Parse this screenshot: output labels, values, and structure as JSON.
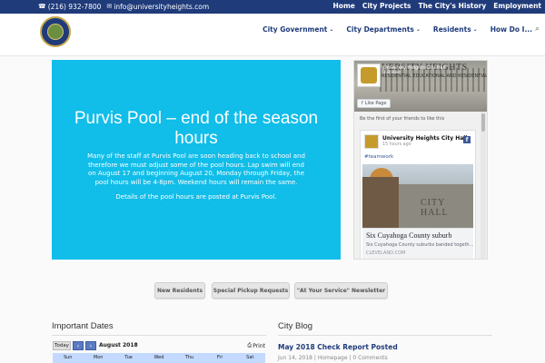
{
  "topbar": {
    "phone": "(216) 932-7800",
    "email": "info@universityheights.com",
    "links": [
      "Home",
      "City Projects",
      "The City's History",
      "Employment"
    ]
  },
  "nav": {
    "items": [
      "City Government",
      "City Departments",
      "Residents",
      "How Do I..."
    ]
  },
  "hero": {
    "title": "Purvis Pool – end of the season hours",
    "body": "Many of the staff at Purvis Pool are soon heading back to school and therefore we must adjust some of the pool hours. Lap swim will end on August 17 and beginning August 20, Monday through Friday, the pool hours will be 4-8pm. Weekend hours will remain the same.",
    "note": "Details of the pool hours are posted at Purvis Pool.",
    "background": "#11bde9"
  },
  "facebook": {
    "cover_text": "VERSITY HEIGHTS",
    "cover_subtext": "RESIDENTIAL EDUCATIONAL AND RESIDENTIAL",
    "page_name": "University Heights City Hall",
    "likes": "2,8 likes",
    "like_button": "Like Page",
    "friends_text": "Be the first of your friends to like this",
    "post_author": "University Heights City Hall",
    "post_time": "15 hours ago",
    "post_tag": "#teamwork",
    "photo_sign": "CITY HALL",
    "link_title": "Six Cuyahoga County suburb",
    "link_desc": "Six Cuyahoga County suburbs banded togeth...",
    "link_domain": "CLEVELAND.COM"
  },
  "buttons": {
    "new_residents": "New Residents",
    "special_pickup": "Special Pickup Requests",
    "newsletter": "\"At Your Service\" Newsletter"
  },
  "important_dates": {
    "title": "Important Dates",
    "today_label": "Today",
    "month": "August 2018",
    "print_label": "Print",
    "weekdays": [
      "Sun",
      "Mon",
      "Tue",
      "Wed",
      "Thu",
      "Fri",
      "Sat"
    ]
  },
  "city_blog": {
    "title": "City Blog",
    "post_title": "May 2018 Check Report Posted",
    "post_meta": "Jun 14, 2018 | Homepage | 0 Comments"
  }
}
